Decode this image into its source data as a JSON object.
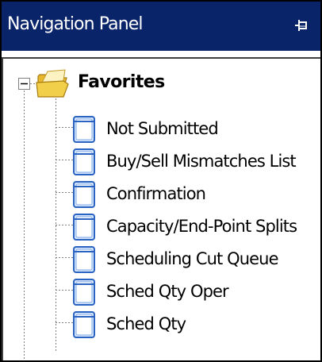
{
  "panel": {
    "title": "Navigation Panel",
    "pin_icon": "pin-icon",
    "colors": {
      "title_bar": "#0a246a",
      "title_text": "#ffffff",
      "doc_icon_blue": "#3a7fd8",
      "folder_yellow": "#f2cf4a"
    }
  },
  "tree": {
    "folder": {
      "label": "Favorites",
      "icon": "folder-icon",
      "expander_icon": "collapse-minus-icon",
      "expanded": true
    },
    "items": [
      {
        "label": "Not Submitted",
        "icon": "document-icon"
      },
      {
        "label": "Buy/Sell Mismatches List",
        "icon": "document-icon"
      },
      {
        "label": "Confirmation",
        "icon": "document-icon"
      },
      {
        "label": "Capacity/End-Point Splits",
        "icon": "document-icon"
      },
      {
        "label": "Scheduling Cut Queue",
        "icon": "document-icon"
      },
      {
        "label": "Sched Qty Oper",
        "icon": "document-icon"
      },
      {
        "label": "Sched Qty",
        "icon": "document-icon"
      }
    ]
  }
}
